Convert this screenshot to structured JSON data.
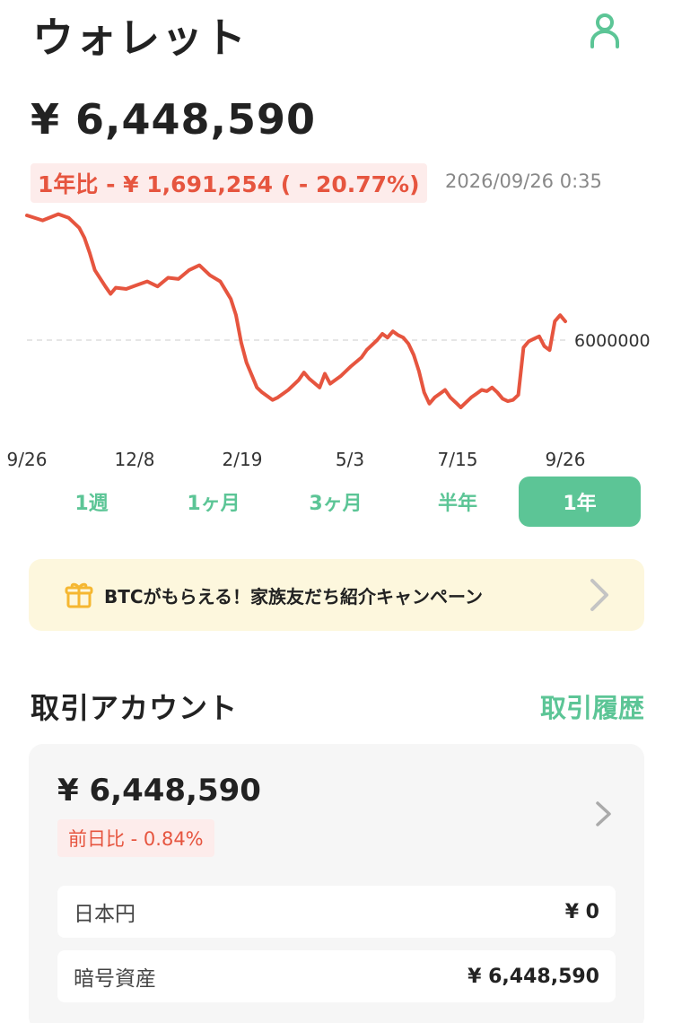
{
  "header": {
    "title": "ウォレット"
  },
  "wallet": {
    "balance": "¥ 6,448,590",
    "change_label": "1年比 - ¥ 1,691,254 ( - 20.77%)",
    "timestamp": "2026/09/26 0:35"
  },
  "chart_data": {
    "type": "line",
    "title": "",
    "xlabel": "",
    "ylabel": "",
    "reference_line": {
      "value": 6000000,
      "label": "6000000"
    },
    "x_ticks": [
      "9/26",
      "12/8",
      "2/19",
      "5/3",
      "7/15",
      "9/26"
    ],
    "grid": false,
    "series": [
      {
        "color": "#e6553f",
        "points": [
          [
            0,
            7000000
          ],
          [
            3,
            6960000
          ],
          [
            6,
            7010000
          ],
          [
            8,
            6980000
          ],
          [
            10,
            6900000
          ],
          [
            11,
            6820000
          ],
          [
            12,
            6700000
          ],
          [
            13,
            6560000
          ],
          [
            15,
            6430000
          ],
          [
            16,
            6370000
          ],
          [
            17,
            6420000
          ],
          [
            19,
            6410000
          ],
          [
            21,
            6440000
          ],
          [
            23,
            6470000
          ],
          [
            25,
            6430000
          ],
          [
            27,
            6500000
          ],
          [
            29,
            6490000
          ],
          [
            31,
            6560000
          ],
          [
            33,
            6600000
          ],
          [
            35,
            6520000
          ],
          [
            37,
            6470000
          ],
          [
            39,
            6330000
          ],
          [
            40,
            6200000
          ],
          [
            41,
            5980000
          ],
          [
            42,
            5820000
          ],
          [
            43,
            5720000
          ],
          [
            44,
            5620000
          ],
          [
            45,
            5580000
          ],
          [
            46,
            5550000
          ],
          [
            47,
            5520000
          ],
          [
            48,
            5540000
          ],
          [
            49,
            5570000
          ],
          [
            50,
            5600000
          ],
          [
            52,
            5680000
          ],
          [
            53,
            5740000
          ],
          [
            54,
            5690000
          ],
          [
            56,
            5620000
          ],
          [
            57,
            5730000
          ],
          [
            58,
            5650000
          ],
          [
            60,
            5710000
          ],
          [
            62,
            5790000
          ],
          [
            64,
            5860000
          ],
          [
            65,
            5920000
          ],
          [
            66,
            5960000
          ],
          [
            67,
            6000000
          ],
          [
            68,
            6050000
          ],
          [
            69,
            6020000
          ],
          [
            70,
            6070000
          ],
          [
            71,
            6040000
          ],
          [
            72,
            6020000
          ],
          [
            73,
            5970000
          ],
          [
            74,
            5880000
          ],
          [
            75,
            5750000
          ],
          [
            76,
            5580000
          ],
          [
            77,
            5490000
          ],
          [
            78,
            5540000
          ],
          [
            79,
            5570000
          ],
          [
            80,
            5600000
          ],
          [
            81,
            5540000
          ],
          [
            82,
            5500000
          ],
          [
            83,
            5460000
          ],
          [
            84,
            5500000
          ],
          [
            85,
            5540000
          ],
          [
            86,
            5570000
          ],
          [
            87,
            5600000
          ],
          [
            88,
            5590000
          ],
          [
            89,
            5620000
          ],
          [
            90,
            5580000
          ],
          [
            91,
            5530000
          ],
          [
            92,
            5510000
          ],
          [
            93,
            5520000
          ],
          [
            94,
            5560000
          ],
          [
            95,
            5940000
          ],
          [
            96,
            5990000
          ],
          [
            97,
            6010000
          ],
          [
            98,
            6030000
          ],
          [
            99,
            5950000
          ],
          [
            100,
            5920000
          ],
          [
            101,
            6150000
          ],
          [
            102,
            6200000
          ],
          [
            103,
            6150000
          ]
        ]
      }
    ]
  },
  "periods": [
    {
      "label": "1週",
      "active": false
    },
    {
      "label": "1ヶ月",
      "active": false
    },
    {
      "label": "3ヶ月",
      "active": false
    },
    {
      "label": "半年",
      "active": false
    },
    {
      "label": "1年",
      "active": true
    }
  ],
  "banner": {
    "text": "BTCがもらえる！家族友だち紹介キャンペーン",
    "icon": "gift-icon"
  },
  "account": {
    "section_title": "取引アカウント",
    "history_link": "取引履歴",
    "balance": "¥ 6,448,590",
    "change_label": "前日比 - 0.84%",
    "rows": [
      {
        "label": "日本円",
        "value": "¥ 0"
      },
      {
        "label": "暗号資産",
        "value": "¥ 6,448,590"
      }
    ]
  },
  "colors": {
    "accent": "#5cc596",
    "negative": "#e6553f",
    "negative_bg": "#fdeceb",
    "banner_bg": "#fdf7dd",
    "card_bg": "#f6f6f6"
  }
}
